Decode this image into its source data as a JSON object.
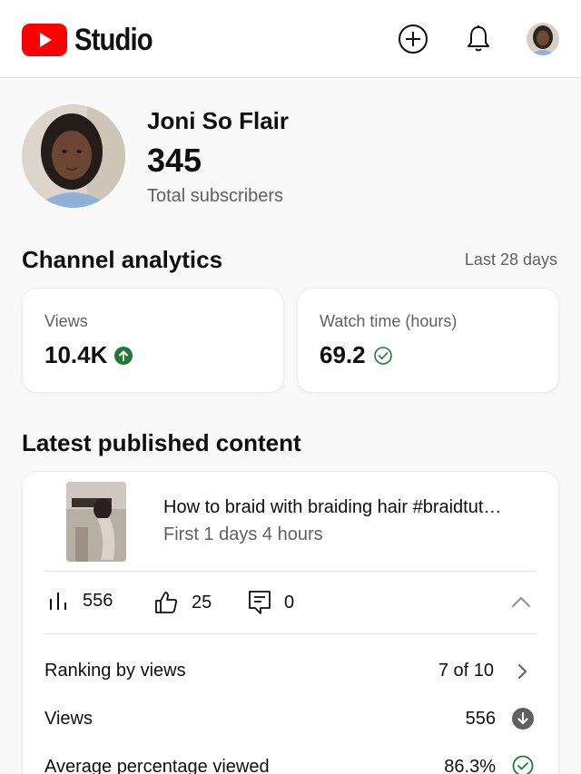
{
  "header": {
    "app_name": "Studio",
    "icons": [
      "create-icon",
      "notifications-icon",
      "account-avatar"
    ]
  },
  "channel": {
    "name": "Joni So Flair",
    "subscribers": "345",
    "subscribers_label": "Total subscribers"
  },
  "analytics": {
    "title": "Channel analytics",
    "period": "Last 28 days",
    "metrics": [
      {
        "label": "Views",
        "value": "10.4K",
        "status_icon": "arrow-up-circle-icon"
      },
      {
        "label": "Watch time (hours)",
        "value": "69.2",
        "status_icon": "check-circle-icon"
      }
    ]
  },
  "latest": {
    "title": "Latest published content",
    "video": {
      "title": "How to braid with braiding hair #braidtut…",
      "subtitle": "First 1 days 4 hours",
      "views": "556",
      "likes": "25",
      "comments": "0"
    },
    "rows": [
      {
        "label": "Ranking by views",
        "value": "7 of 10",
        "icon": "chevron-right-icon"
      },
      {
        "label": "Views",
        "value": "556",
        "icon": "arrow-down-circle-icon"
      },
      {
        "label": "Average percentage viewed",
        "value": "86.3%",
        "icon": "check-circle-icon"
      }
    ]
  },
  "colors": {
    "brand_red": "#ff0000",
    "trend_up_green": "#1e7a34",
    "text_primary": "#0f0f0f",
    "text_secondary": "#606060",
    "neutral_dark": "#606060"
  }
}
